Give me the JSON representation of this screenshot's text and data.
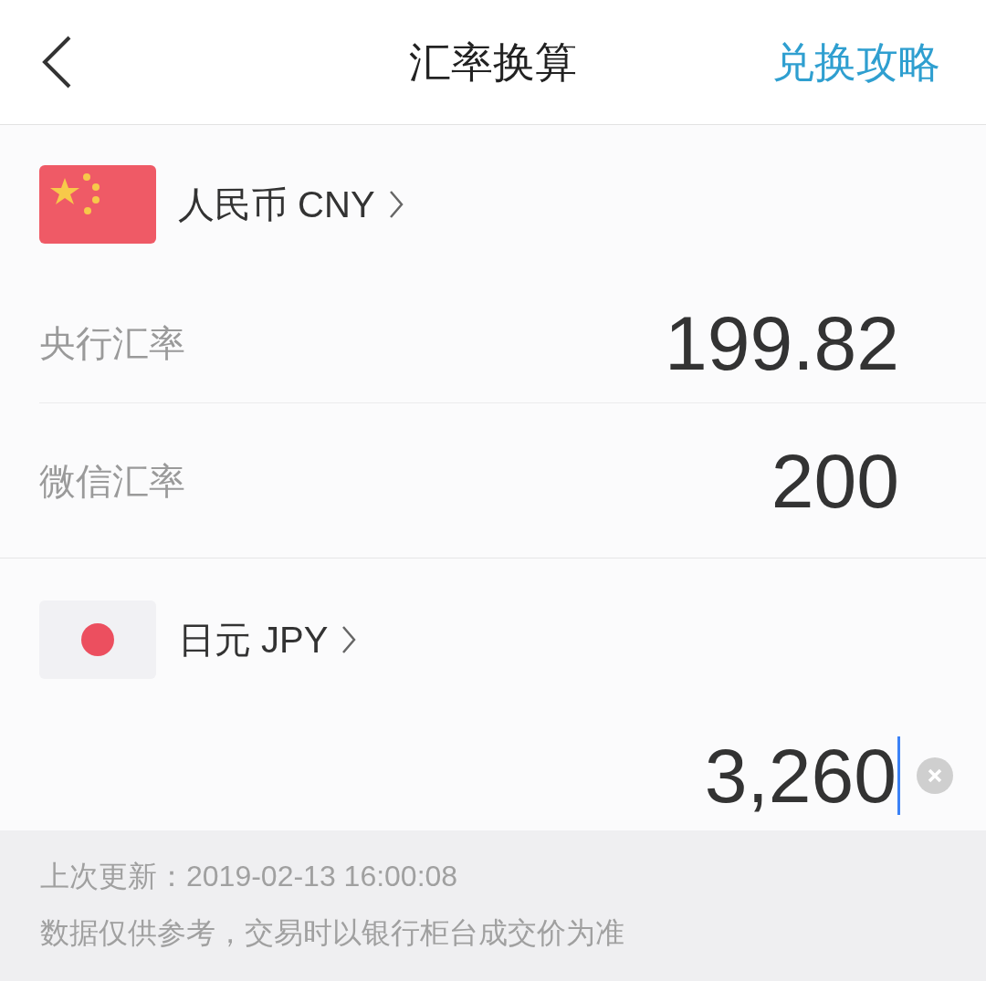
{
  "header": {
    "title": "汇率换算",
    "action": "兑换攻略"
  },
  "currencies": [
    {
      "name": "人民币 CNY",
      "kind": "cn",
      "rows": [
        {
          "label": "央行汇率",
          "value": "199.82"
        },
        {
          "label": "微信汇率",
          "value": "200"
        }
      ]
    },
    {
      "name": "日元 JPY",
      "kind": "jp",
      "input": {
        "value": "3,260",
        "focused": true
      }
    }
  ],
  "footer": {
    "updated": "上次更新：2019-02-13 16:00:08",
    "note": "数据仅供参考，交易时以银行柜台成交价为准"
  }
}
